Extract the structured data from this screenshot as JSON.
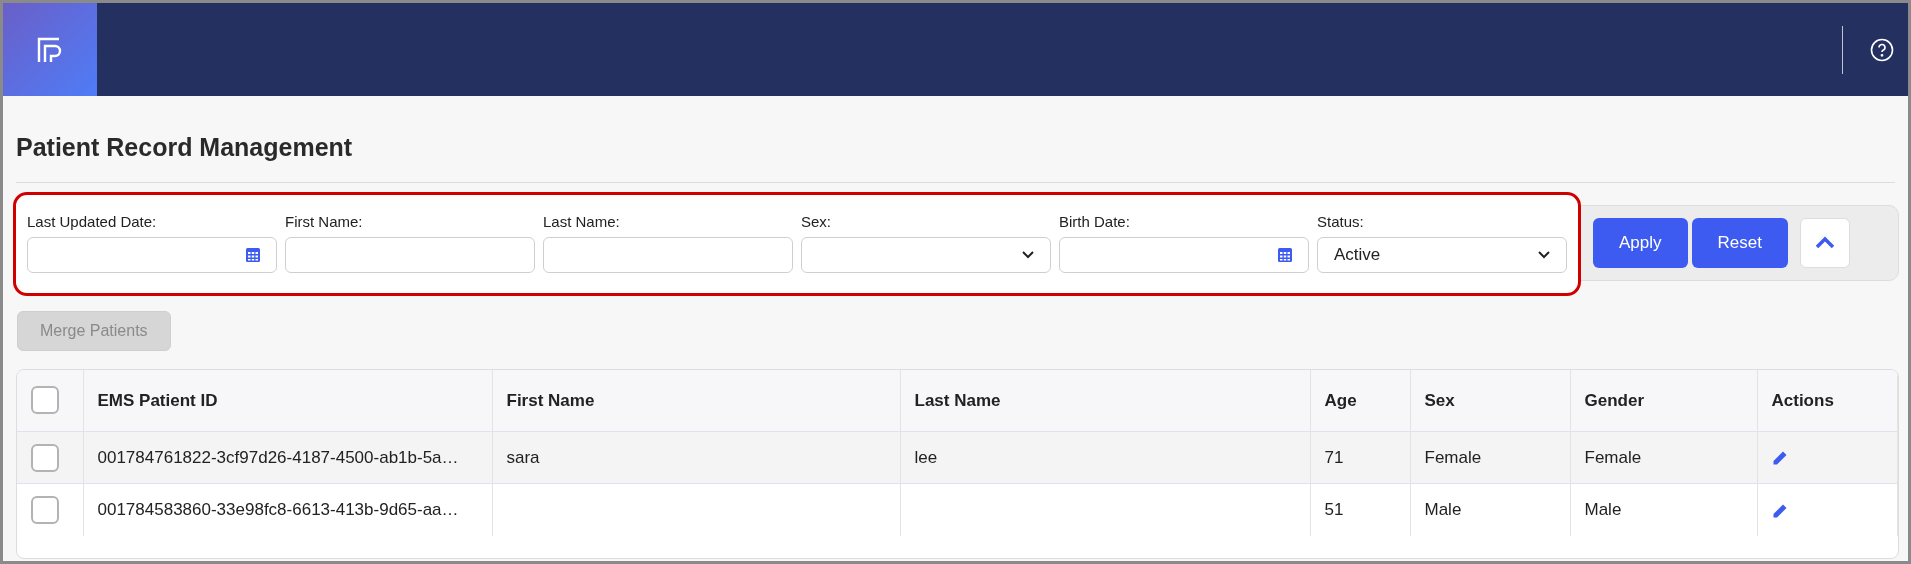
{
  "page": {
    "title": "Patient Record Management"
  },
  "filters": [
    {
      "label": "Last Updated Date:",
      "kind": "date"
    },
    {
      "label": "First Name:",
      "kind": "text"
    },
    {
      "label": "Last Name:",
      "kind": "text"
    },
    {
      "label": "Sex:",
      "kind": "select"
    },
    {
      "label": "Birth Date:",
      "kind": "date"
    },
    {
      "label": "Status:",
      "kind": "select",
      "value": "Active"
    }
  ],
  "filter_buttons": [
    "Apply",
    "Reset"
  ],
  "merge_button": {
    "label": "Merge Patients",
    "disabled": true
  },
  "table": {
    "select_all_checked": false,
    "columns": [
      "EMS Patient ID",
      "First Name",
      "Last Name",
      "Age",
      "Sex",
      "Gender",
      "Actions"
    ],
    "rows": [
      {
        "checked": false,
        "cells": [
          "001784761822-3cf97d26-4187-4500-ab1b-5a…",
          "sara",
          "lee",
          "71",
          "Female",
          "Female"
        ]
      },
      {
        "checked": false,
        "cells": [
          "001784583860-33e98fc8-6613-413b-9d65-aa…",
          "",
          "",
          "51",
          "Male",
          "Male"
        ]
      }
    ]
  }
}
